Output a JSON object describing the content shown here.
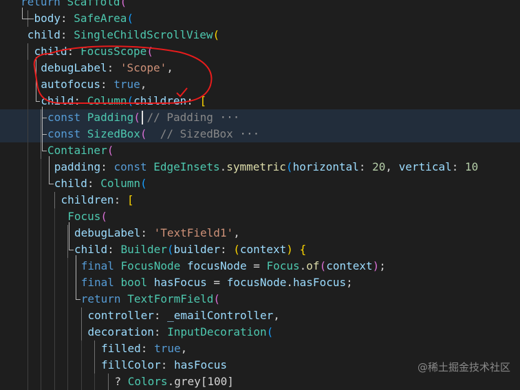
{
  "editor": {
    "lines": [
      {
        "segs": [
          {
            "t": "return ",
            "c": "k"
          },
          {
            "t": "Scaffold",
            "c": "t"
          },
          {
            "t": "(",
            "c": "b1"
          }
        ]
      },
      {
        "segs": [
          {
            "t": "body",
            "c": "p"
          },
          {
            "t": ": ",
            "c": "pl"
          },
          {
            "t": "SafeArea",
            "c": "t"
          },
          {
            "t": "(",
            "c": "b2"
          }
        ]
      },
      {
        "segs": [
          {
            "t": "child",
            "c": "p"
          },
          {
            "t": ": ",
            "c": "pl"
          },
          {
            "t": "SingleChildScrollView",
            "c": "t"
          },
          {
            "t": "(",
            "c": "b3"
          }
        ]
      },
      {
        "segs": [
          {
            "t": "child",
            "c": "p"
          },
          {
            "t": ": ",
            "c": "pl"
          },
          {
            "t": "FocusScope",
            "c": "t"
          },
          {
            "t": "(",
            "c": "b1"
          }
        ]
      },
      {
        "segs": [
          {
            "t": "debugLabel",
            "c": "p"
          },
          {
            "t": ": ",
            "c": "pl"
          },
          {
            "t": "'Scope'",
            "c": "s"
          },
          {
            "t": ",",
            "c": "pl"
          }
        ]
      },
      {
        "segs": [
          {
            "t": "autofocus",
            "c": "p"
          },
          {
            "t": ": ",
            "c": "pl"
          },
          {
            "t": "true",
            "c": "k"
          },
          {
            "t": ",",
            "c": "pl"
          }
        ]
      },
      {
        "segs": [
          {
            "t": "child",
            "c": "p"
          },
          {
            "t": ": ",
            "c": "pl"
          },
          {
            "t": "Column",
            "c": "t"
          },
          {
            "t": "(",
            "c": "b2"
          },
          {
            "t": "children",
            "c": "p"
          },
          {
            "t": ": ",
            "c": "pl"
          },
          {
            "t": "[",
            "c": "b3"
          }
        ]
      },
      {
        "segs": [
          {
            "t": "const ",
            "c": "k"
          },
          {
            "t": "Padding",
            "c": "t"
          },
          {
            "t": "(",
            "c": "b1"
          },
          {
            "t": " // Padding ",
            "c": "c"
          },
          {
            "t": "···",
            "c": "fold"
          }
        ]
      },
      {
        "segs": [
          {
            "t": "const ",
            "c": "k"
          },
          {
            "t": "SizedBox",
            "c": "t"
          },
          {
            "t": "(",
            "c": "b1"
          },
          {
            "t": "  // SizedBox ",
            "c": "c"
          },
          {
            "t": "···",
            "c": "fold"
          }
        ]
      },
      {
        "segs": [
          {
            "t": "Container",
            "c": "t"
          },
          {
            "t": "(",
            "c": "b1"
          }
        ]
      },
      {
        "segs": [
          {
            "t": "padding",
            "c": "p"
          },
          {
            "t": ": ",
            "c": "pl"
          },
          {
            "t": "const ",
            "c": "k"
          },
          {
            "t": "EdgeInsets",
            "c": "t"
          },
          {
            "t": ".",
            "c": "pl"
          },
          {
            "t": "symmetric",
            "c": "f"
          },
          {
            "t": "(",
            "c": "b2"
          },
          {
            "t": "horizontal",
            "c": "p"
          },
          {
            "t": ": ",
            "c": "pl"
          },
          {
            "t": "20",
            "c": "n"
          },
          {
            "t": ", ",
            "c": "pl"
          },
          {
            "t": "vertical",
            "c": "p"
          },
          {
            "t": ": ",
            "c": "pl"
          },
          {
            "t": "10",
            "c": "n"
          }
        ]
      },
      {
        "segs": [
          {
            "t": "child",
            "c": "p"
          },
          {
            "t": ": ",
            "c": "pl"
          },
          {
            "t": "Column",
            "c": "t"
          },
          {
            "t": "(",
            "c": "b2"
          }
        ]
      },
      {
        "segs": [
          {
            "t": "children",
            "c": "p"
          },
          {
            "t": ": ",
            "c": "pl"
          },
          {
            "t": "[",
            "c": "b3"
          }
        ]
      },
      {
        "segs": [
          {
            "t": "Focus",
            "c": "t"
          },
          {
            "t": "(",
            "c": "b1"
          }
        ]
      },
      {
        "segs": [
          {
            "t": "debugLabel",
            "c": "p"
          },
          {
            "t": ": ",
            "c": "pl"
          },
          {
            "t": "'TextField1'",
            "c": "s"
          },
          {
            "t": ",",
            "c": "pl"
          }
        ]
      },
      {
        "segs": [
          {
            "t": "child",
            "c": "p"
          },
          {
            "t": ": ",
            "c": "pl"
          },
          {
            "t": "Builder",
            "c": "t"
          },
          {
            "t": "(",
            "c": "b2"
          },
          {
            "t": "builder",
            "c": "p"
          },
          {
            "t": ": ",
            "c": "pl"
          },
          {
            "t": "(",
            "c": "b3"
          },
          {
            "t": "context",
            "c": "p"
          },
          {
            "t": ")",
            "c": "b3"
          },
          {
            "t": " {",
            "c": "b3"
          }
        ]
      },
      {
        "segs": [
          {
            "t": "final ",
            "c": "k"
          },
          {
            "t": "FocusNode ",
            "c": "t"
          },
          {
            "t": "focusNode",
            "c": "p"
          },
          {
            "t": " = ",
            "c": "pl"
          },
          {
            "t": "Focus",
            "c": "t"
          },
          {
            "t": ".",
            "c": "pl"
          },
          {
            "t": "of",
            "c": "f"
          },
          {
            "t": "(",
            "c": "b1"
          },
          {
            "t": "context",
            "c": "p"
          },
          {
            "t": ")",
            "c": "b1"
          },
          {
            "t": ";",
            "c": "pl"
          }
        ]
      },
      {
        "segs": [
          {
            "t": "final ",
            "c": "k"
          },
          {
            "t": "bool ",
            "c": "t"
          },
          {
            "t": "hasFocus",
            "c": "p"
          },
          {
            "t": " = ",
            "c": "pl"
          },
          {
            "t": "focusNode",
            "c": "p"
          },
          {
            "t": ".",
            "c": "pl"
          },
          {
            "t": "hasFocus",
            "c": "p"
          },
          {
            "t": ";",
            "c": "pl"
          }
        ]
      },
      {
        "segs": [
          {
            "t": "return ",
            "c": "k"
          },
          {
            "t": "TextFormField",
            "c": "t"
          },
          {
            "t": "(",
            "c": "b1"
          }
        ]
      },
      {
        "segs": [
          {
            "t": "controller",
            "c": "p"
          },
          {
            "t": ": ",
            "c": "pl"
          },
          {
            "t": "_emailController",
            "c": "p"
          },
          {
            "t": ",",
            "c": "pl"
          }
        ]
      },
      {
        "segs": [
          {
            "t": "decoration",
            "c": "p"
          },
          {
            "t": ": ",
            "c": "pl"
          },
          {
            "t": "InputDecoration",
            "c": "t"
          },
          {
            "t": "(",
            "c": "b2"
          }
        ]
      },
      {
        "segs": [
          {
            "t": "filled",
            "c": "p"
          },
          {
            "t": ": ",
            "c": "pl"
          },
          {
            "t": "true",
            "c": "k"
          },
          {
            "t": ",",
            "c": "pl"
          }
        ]
      },
      {
        "segs": [
          {
            "t": "fillColor",
            "c": "p"
          },
          {
            "t": ": ",
            "c": "pl"
          },
          {
            "t": "hasFocus",
            "c": "p"
          }
        ]
      },
      {
        "segs": [
          {
            "t": "? ",
            "c": "pl"
          },
          {
            "t": "Colors",
            "c": "t"
          },
          {
            "t": ".grey[100]",
            "c": "pl"
          }
        ]
      }
    ]
  },
  "colors": {
    "background": "#1e1e1e",
    "keyword": "#569cd6",
    "type": "#4ec9b0",
    "property": "#9cdcfe",
    "string": "#ce9178",
    "annotation_ring": "#e81c1c"
  },
  "icons": {
    "lightbulb": "lightbulb-icon",
    "annotation_check": "checkmark-icon"
  },
  "watermark": "@稀土掘金技术社区"
}
